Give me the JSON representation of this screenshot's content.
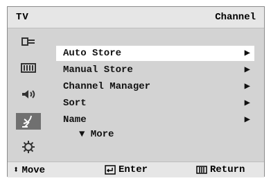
{
  "header": {
    "left": "TV",
    "right": "Channel"
  },
  "sidebar": {
    "icons": [
      {
        "name": "input-icon"
      },
      {
        "name": "picture-icon"
      },
      {
        "name": "sound-icon"
      },
      {
        "name": "channel-icon"
      },
      {
        "name": "setup-icon"
      }
    ]
  },
  "menu": {
    "items": [
      {
        "label": "Auto Store"
      },
      {
        "label": "Manual Store"
      },
      {
        "label": "Channel Manager"
      },
      {
        "label": "Sort"
      },
      {
        "label": "Name"
      }
    ],
    "more": "▼ More"
  },
  "footer": {
    "move": "Move",
    "enter": "Enter",
    "return": "Return"
  },
  "colors": {
    "panel": "#d3d3d3",
    "highlight": "#ffffff",
    "selected_icon_bg": "#707070"
  }
}
